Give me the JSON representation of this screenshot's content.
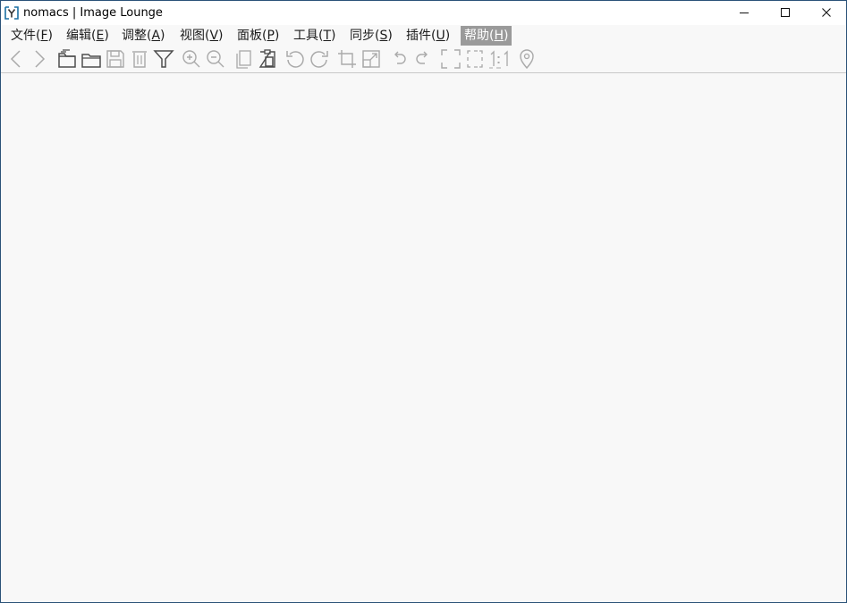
{
  "window": {
    "title": "nomacs | Image Lounge",
    "app_icon": "nomacs-logo-icon",
    "controls": [
      "minimize-icon",
      "maximize-icon",
      "close-icon"
    ]
  },
  "menu": {
    "items": [
      {
        "label": "文件(F)",
        "prefix": "文件(",
        "key": "F",
        "suffix": ")"
      },
      {
        "label": "编辑(E)",
        "prefix": "编辑(",
        "key": "E",
        "suffix": ")"
      },
      {
        "label": "调整(A)",
        "prefix": "调整(",
        "key": "A",
        "suffix": ")"
      },
      {
        "label": "视图(V)",
        "prefix": "视图(",
        "key": "V",
        "suffix": ")"
      },
      {
        "label": "面板(P)",
        "prefix": "面板(",
        "key": "P",
        "suffix": ")"
      },
      {
        "label": "工具(T)",
        "prefix": "工具(",
        "key": "T",
        "suffix": ")"
      },
      {
        "label": "同步(S)",
        "prefix": "同步(",
        "key": "S",
        "suffix": ")"
      },
      {
        "label": "插件(U)",
        "prefix": "插件(",
        "key": "U",
        "suffix": ")"
      },
      {
        "label": "帮助(H)",
        "prefix": "帮助(",
        "key": "H",
        "suffix": ")"
      }
    ],
    "active_item": "帮助(H)"
  },
  "toolbar": {
    "icons": [
      "previous-icon",
      "next-icon",
      "open-browse-icon",
      "open-folder-icon",
      "save-icon",
      "delete-icon",
      "filter-icon",
      "zoom-in-icon",
      "zoom-out-icon",
      "copy-icon",
      "paste-icon",
      "rotate-left-icon",
      "rotate-right-icon",
      "crop-icon",
      "resize-icon",
      "undo-icon",
      "redo-icon",
      "fullscreen-icon",
      "fit-frame-icon",
      "one-to-one-icon",
      "gps-marker-icon"
    ],
    "one_to_one_label": "1:1"
  },
  "colors": {
    "icon_enabled": "#4d4d4d",
    "icon_disabled": "#a9a9a9",
    "menu_active_bg": "#9a9a9a",
    "canvas_bg": "#f8f8f8",
    "window_border": "#2b5278"
  }
}
